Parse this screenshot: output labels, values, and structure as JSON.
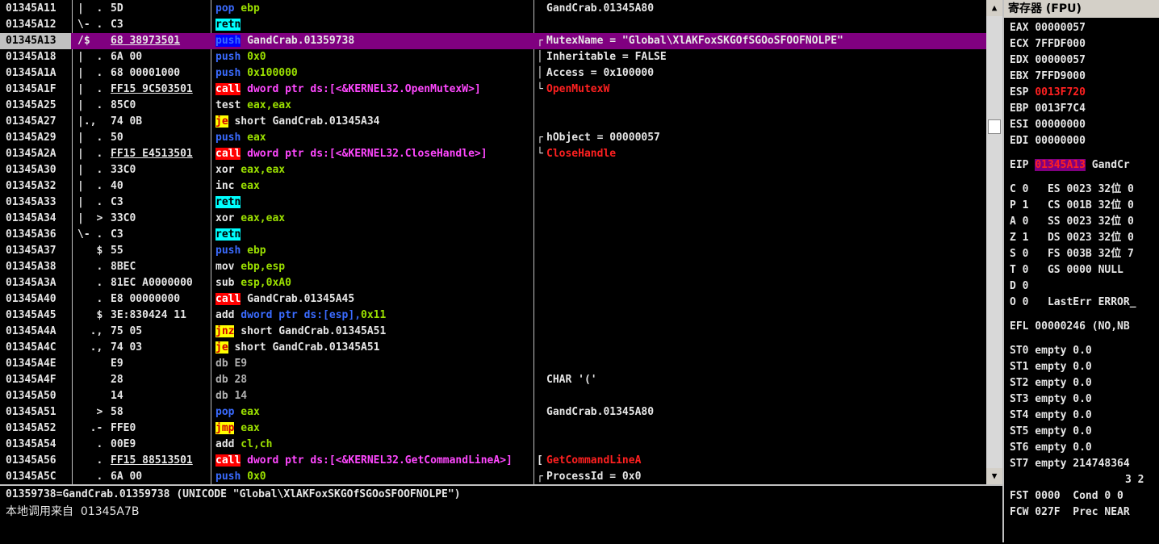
{
  "disasm": {
    "rows": [
      {
        "addr": "01345A11",
        "mark": "|  .",
        "hex": "5D",
        "dis": [
          [
            "pop",
            "m-blue"
          ],
          [
            " ebp",
            "op-green"
          ]
        ],
        "cmt": "GandCrab.01345A80"
      },
      {
        "addr": "01345A12",
        "mark": "\\- .",
        "hex": "C3",
        "dis": [
          [
            "retn",
            "m-ret"
          ]
        ],
        "cmt": ""
      },
      {
        "addr": "01345A13",
        "mark": "/$",
        "hex": "68 38973501",
        "hexUl": true,
        "dis": [
          [
            "push",
            "m-blue-bg"
          ],
          [
            " GandCrab.01359738",
            "op-white"
          ]
        ],
        "cmt": "MutexName = \"Global\\XlAKFoxSKGOfSGOoSFOOFNOLPE\"",
        "brace": "┌",
        "sel": true
      },
      {
        "addr": "01345A18",
        "mark": "|  .",
        "hex": "6A 00",
        "dis": [
          [
            "push",
            "m-blue"
          ],
          [
            " 0x0",
            "op-green"
          ]
        ],
        "cmt": "Inheritable = FALSE",
        "brace": "│"
      },
      {
        "addr": "01345A1A",
        "mark": "|  .",
        "hex": "68 00001000",
        "dis": [
          [
            "push",
            "m-blue"
          ],
          [
            " 0x100000",
            "op-green"
          ]
        ],
        "cmt": "Access = 0x100000",
        "brace": "│"
      },
      {
        "addr": "01345A1F",
        "mark": "|  .",
        "hex": "FF15 9C503501",
        "hexUl": true,
        "dis": [
          [
            "call",
            "m-call"
          ],
          [
            " dword ptr ds:[<&KERNEL32.OpenMutexW>]",
            "op-pink"
          ]
        ],
        "cmt": "OpenMutexW",
        "cmtClass": "cmt-red",
        "brace": "└"
      },
      {
        "addr": "01345A25",
        "mark": "|  .",
        "hex": "85C0",
        "dis": [
          [
            "test",
            "m-plain"
          ],
          [
            " eax,eax",
            "op-green"
          ]
        ],
        "cmt": ""
      },
      {
        "addr": "01345A27",
        "mark": "|.,",
        "hex": "74 0B",
        "dis": [
          [
            "je",
            "m-jmp"
          ],
          [
            " short GandCrab.01345A34",
            "op-white"
          ]
        ],
        "cmt": ""
      },
      {
        "addr": "01345A29",
        "mark": "|  .",
        "hex": "50",
        "dis": [
          [
            "push",
            "m-blue"
          ],
          [
            " eax",
            "op-green"
          ]
        ],
        "cmt": "hObject = 00000057",
        "brace": "┌"
      },
      {
        "addr": "01345A2A",
        "mark": "|  .",
        "hex": "FF15 E4513501",
        "hexUl": true,
        "dis": [
          [
            "call",
            "m-call"
          ],
          [
            " dword ptr ds:[<&KERNEL32.CloseHandle>]",
            "op-pink"
          ]
        ],
        "cmt": "CloseHandle",
        "cmtClass": "cmt-red",
        "brace": "└"
      },
      {
        "addr": "01345A30",
        "mark": "|  .",
        "hex": "33C0",
        "dis": [
          [
            "xor",
            "m-plain"
          ],
          [
            " eax,eax",
            "op-green"
          ]
        ],
        "cmt": ""
      },
      {
        "addr": "01345A32",
        "mark": "|  .",
        "hex": "40",
        "dis": [
          [
            "inc",
            "m-plain"
          ],
          [
            " eax",
            "op-green"
          ]
        ],
        "cmt": ""
      },
      {
        "addr": "01345A33",
        "mark": "|  .",
        "hex": "C3",
        "dis": [
          [
            "retn",
            "m-ret"
          ]
        ],
        "cmt": ""
      },
      {
        "addr": "01345A34",
        "mark": "|  >",
        "hex": "33C0",
        "dis": [
          [
            "xor",
            "m-plain"
          ],
          [
            " eax,eax",
            "op-green"
          ]
        ],
        "cmt": ""
      },
      {
        "addr": "01345A36",
        "mark": "\\- .",
        "hex": "C3",
        "dis": [
          [
            "retn",
            "m-ret"
          ]
        ],
        "cmt": ""
      },
      {
        "addr": "01345A37",
        "mark": "   $",
        "hex": "55",
        "dis": [
          [
            "push",
            "m-blue"
          ],
          [
            " ebp",
            "op-green"
          ]
        ],
        "cmt": ""
      },
      {
        "addr": "01345A38",
        "mark": "   .",
        "hex": "8BEC",
        "dis": [
          [
            "mov",
            "m-plain"
          ],
          [
            " ebp,esp",
            "op-green"
          ]
        ],
        "cmt": ""
      },
      {
        "addr": "01345A3A",
        "mark": "   .",
        "hex": "81EC A0000000",
        "dis": [
          [
            "sub",
            "m-plain"
          ],
          [
            " esp,",
            "op-green"
          ],
          [
            "0xA0",
            "op-green"
          ]
        ],
        "cmt": ""
      },
      {
        "addr": "01345A40",
        "mark": "   .",
        "hex": "E8 00000000",
        "dis": [
          [
            "call",
            "m-call"
          ],
          [
            " GandCrab.01345A45",
            "op-white"
          ]
        ],
        "cmt": ""
      },
      {
        "addr": "01345A45",
        "mark": "   $",
        "hex": "3E:830424 11",
        "dis": [
          [
            "add",
            "m-plain"
          ],
          [
            " dword ptr ds:[esp],",
            "m-blue"
          ],
          [
            "0x11",
            "op-green"
          ]
        ],
        "cmt": ""
      },
      {
        "addr": "01345A4A",
        "mark": "  .,",
        "hex": "75 05",
        "dis": [
          [
            "jnz",
            "m-jmp"
          ],
          [
            " short GandCrab.01345A51",
            "op-white"
          ]
        ],
        "cmt": ""
      },
      {
        "addr": "01345A4C",
        "mark": "  .,",
        "hex": "74 03",
        "dis": [
          [
            "je",
            "m-jmp"
          ],
          [
            " short GandCrab.01345A51",
            "op-white"
          ]
        ],
        "cmt": ""
      },
      {
        "addr": "01345A4E",
        "mark": "",
        "hex": "E9",
        "dis": [
          [
            "db E9",
            "m-gray"
          ]
        ],
        "cmt": ""
      },
      {
        "addr": "01345A4F",
        "mark": "",
        "hex": "28",
        "dis": [
          [
            "db 28",
            "m-gray"
          ]
        ],
        "cmt": "CHAR '('"
      },
      {
        "addr": "01345A50",
        "mark": "",
        "hex": "14",
        "dis": [
          [
            "db 14",
            "m-gray"
          ]
        ],
        "cmt": ""
      },
      {
        "addr": "01345A51",
        "mark": "   >",
        "hex": "58",
        "dis": [
          [
            "pop",
            "m-blue"
          ],
          [
            " eax",
            "op-green"
          ]
        ],
        "cmt": "GandCrab.01345A80"
      },
      {
        "addr": "01345A52",
        "mark": "  .-",
        "hex": "FFE0",
        "dis": [
          [
            "jmp",
            "m-jmp"
          ],
          [
            " eax",
            "op-green"
          ]
        ],
        "cmt": ""
      },
      {
        "addr": "01345A54",
        "mark": "   .",
        "hex": "00E9",
        "dis": [
          [
            "add",
            "m-plain"
          ],
          [
            " cl,ch",
            "op-green"
          ]
        ],
        "cmt": ""
      },
      {
        "addr": "01345A56",
        "mark": "   .",
        "hex": "FF15 88513501",
        "hexUl": true,
        "dis": [
          [
            "call",
            "m-call"
          ],
          [
            " dword ptr ds:[<&KERNEL32.GetCommandLineA>]",
            "op-pink"
          ]
        ],
        "cmt": "GetCommandLineA",
        "cmtClass": "cmt-red",
        "brace": "["
      },
      {
        "addr": "01345A5C",
        "mark": "   .",
        "hex": "6A 00",
        "dis": [
          [
            "push",
            "m-blue"
          ],
          [
            " 0x0",
            "op-green"
          ]
        ],
        "cmt": "ProcessId = 0x0",
        "brace": "┌"
      }
    ]
  },
  "info": {
    "line1": "01359738=GandCrab.01359738 (UNICODE \"Global\\XlAKFoxSKGOfSGOoSFOOFNOLPE\")",
    "line2": "本地调用来自  01345A7B"
  },
  "registers": {
    "title": "寄存器 (FPU)",
    "gp": [
      {
        "name": "EAX",
        "value": "00000057"
      },
      {
        "name": "ECX",
        "value": "7FFDF000"
      },
      {
        "name": "EDX",
        "value": "00000057"
      },
      {
        "name": "EBX",
        "value": "7FFD9000"
      },
      {
        "name": "ESP",
        "value": "0013F720",
        "red": true
      },
      {
        "name": "EBP",
        "value": "0013F7C4"
      },
      {
        "name": "ESI",
        "value": "00000000"
      },
      {
        "name": "EDI",
        "value": "00000000"
      }
    ],
    "eip": {
      "name": "EIP",
      "value": "01345A13",
      "suffix": " GandCr"
    },
    "flags": [
      "C 0   ES 0023 32位 0",
      "P 1   CS 001B 32位 0",
      "A 0   SS 0023 32位 0",
      "Z 1   DS 0023 32位 0",
      "S 0   FS 003B 32位 7",
      "T 0   GS 0000 NULL",
      "D 0",
      "O 0   LastErr ERROR_"
    ],
    "efl": "EFL 00000246 (NO,NB",
    "st": [
      "ST0 empty 0.0",
      "ST1 empty 0.0",
      "ST2 empty 0.0",
      "ST3 empty 0.0",
      "ST4 empty 0.0",
      "ST5 empty 0.0",
      "ST6 empty 0.0",
      "ST7 empty 214748364"
    ],
    "st_tail": "3 2",
    "fst": "FST 0000  Cond 0 0",
    "fcw": "FCW 027F  Prec NEAR"
  },
  "scrollbar": {
    "up": "▲",
    "down": "▼"
  }
}
